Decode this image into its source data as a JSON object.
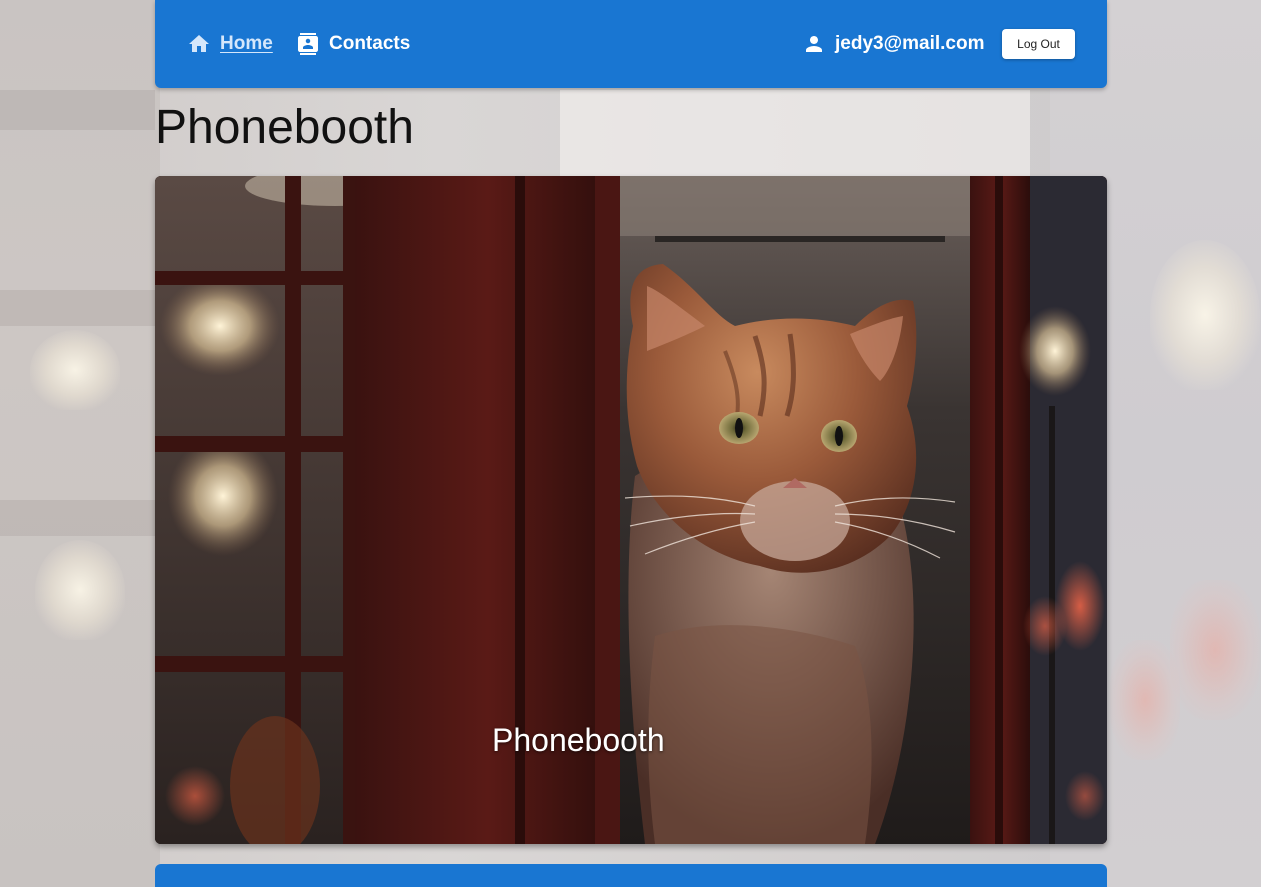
{
  "nav": {
    "home_label": "Home",
    "contacts_label": "Contacts",
    "user_email": "jedy3@mail.com",
    "logout_label": "Log Out",
    "accent": "#1976d2"
  },
  "page": {
    "title": "Phonebooth"
  },
  "hero": {
    "caption": "Phonebooth",
    "image_subject": "cat-in-red-phonebooth"
  },
  "icons": {
    "home": "home-icon",
    "contacts": "contacts-icon",
    "user": "person-icon"
  }
}
